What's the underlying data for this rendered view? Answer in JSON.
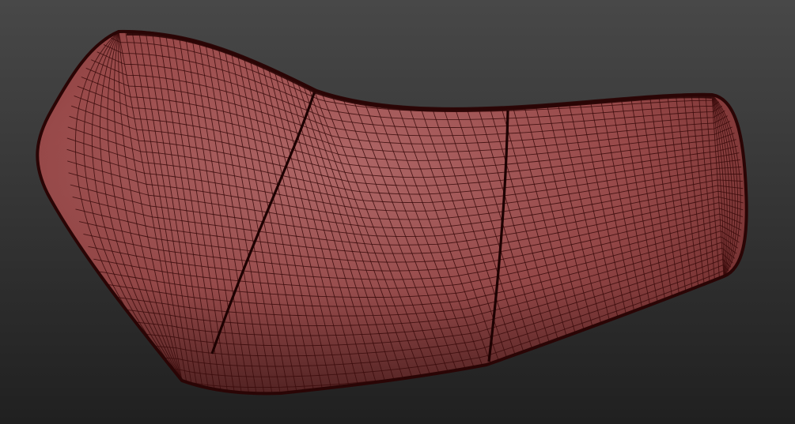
{
  "viewport": {
    "background_top": "#484848",
    "background_bottom": "#202020"
  },
  "model": {
    "name": "cushion-mesh",
    "surface_light": "#b46a6a",
    "surface_mid": "#9b4b4b",
    "surface_dark": "#6e2a2a",
    "wire_color": "#3a0c0c",
    "outline_color": "#2a0505",
    "seam_color": "#1e0202",
    "panels": 3,
    "seams": 2
  }
}
